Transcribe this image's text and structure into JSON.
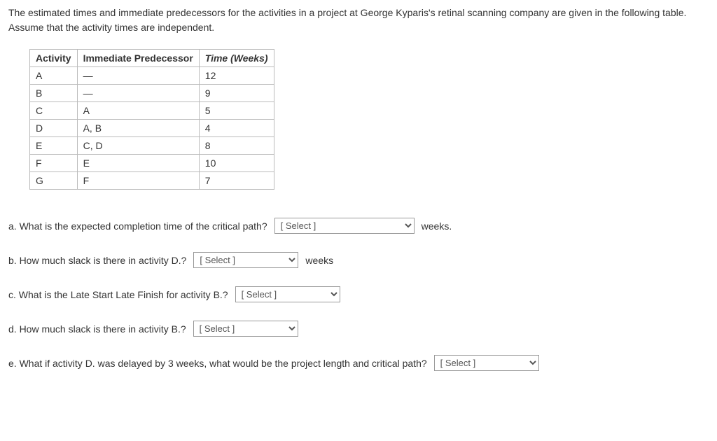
{
  "intro": "The estimated times and immediate predecessors for the activities in a project at George Kyparis's retinal scanning company are given in the following table. Assume that the activity times are independent.",
  "table": {
    "headers": {
      "activity": "Activity",
      "predecessor": "Immediate Predecessor",
      "time": "Time (Weeks)"
    },
    "rows": [
      {
        "activity": "A",
        "predecessor": "—",
        "time": "12"
      },
      {
        "activity": "B",
        "predecessor": "—",
        "time": "9"
      },
      {
        "activity": "C",
        "predecessor": "A",
        "time": "5"
      },
      {
        "activity": "D",
        "predecessor": "A, B",
        "time": "4"
      },
      {
        "activity": "E",
        "predecessor": "C, D",
        "time": "8"
      },
      {
        "activity": "F",
        "predecessor": "E",
        "time": "10"
      },
      {
        "activity": "G",
        "predecessor": "F",
        "time": "7"
      }
    ]
  },
  "questions": {
    "a": {
      "text": "a. What is the expected completion time of the critical path?",
      "select_placeholder": "[ Select ]",
      "suffix": "weeks."
    },
    "b": {
      "text": "b. How much slack is there in activity D.?",
      "select_placeholder": "[ Select ]",
      "suffix": "weeks"
    },
    "c": {
      "text": "c. What is the Late Start Late Finish for activity B.?",
      "select_placeholder": "[ Select ]",
      "suffix": ""
    },
    "d": {
      "text": "d. How much slack is there in activity B.?",
      "select_placeholder": "[ Select ]",
      "suffix": ""
    },
    "e": {
      "text": "e. What if activity D. was delayed by 3 weeks, what would be the project length and critical path?",
      "select_placeholder": "[ Select ]",
      "suffix": ""
    }
  }
}
